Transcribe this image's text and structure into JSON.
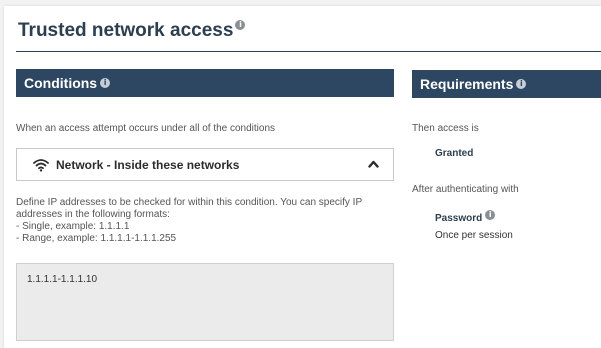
{
  "page": {
    "title": "Trusted network access"
  },
  "conditions": {
    "header": "Conditions",
    "intro": "When an access attempt occurs under all of the conditions",
    "network_panel": {
      "label": "Network - Inside these networks",
      "expanded": true
    },
    "help_lines": [
      "Define IP addresses to be checked for within this condition. You can specify IP",
      "addresses in the following formats:",
      "- Single, example: 1.1.1.1",
      "- Range, example: 1.1.1.1-1.1.1.255"
    ],
    "ip_value": "1.1.1.1-1.1.1.10"
  },
  "requirements": {
    "header": "Requirements",
    "then_access_label": "Then access is",
    "access_value": "Granted",
    "after_auth_label": "After authenticating with",
    "method": "Password",
    "frequency": "Once per session"
  },
  "icons": {
    "info": "info-icon",
    "wifi": "wifi-icon",
    "chevron": "chevron-up-icon"
  },
  "colors": {
    "header_bg": "#2d4661",
    "title_text": "#2c3e50",
    "ip_box_bg": "#ebebeb"
  }
}
